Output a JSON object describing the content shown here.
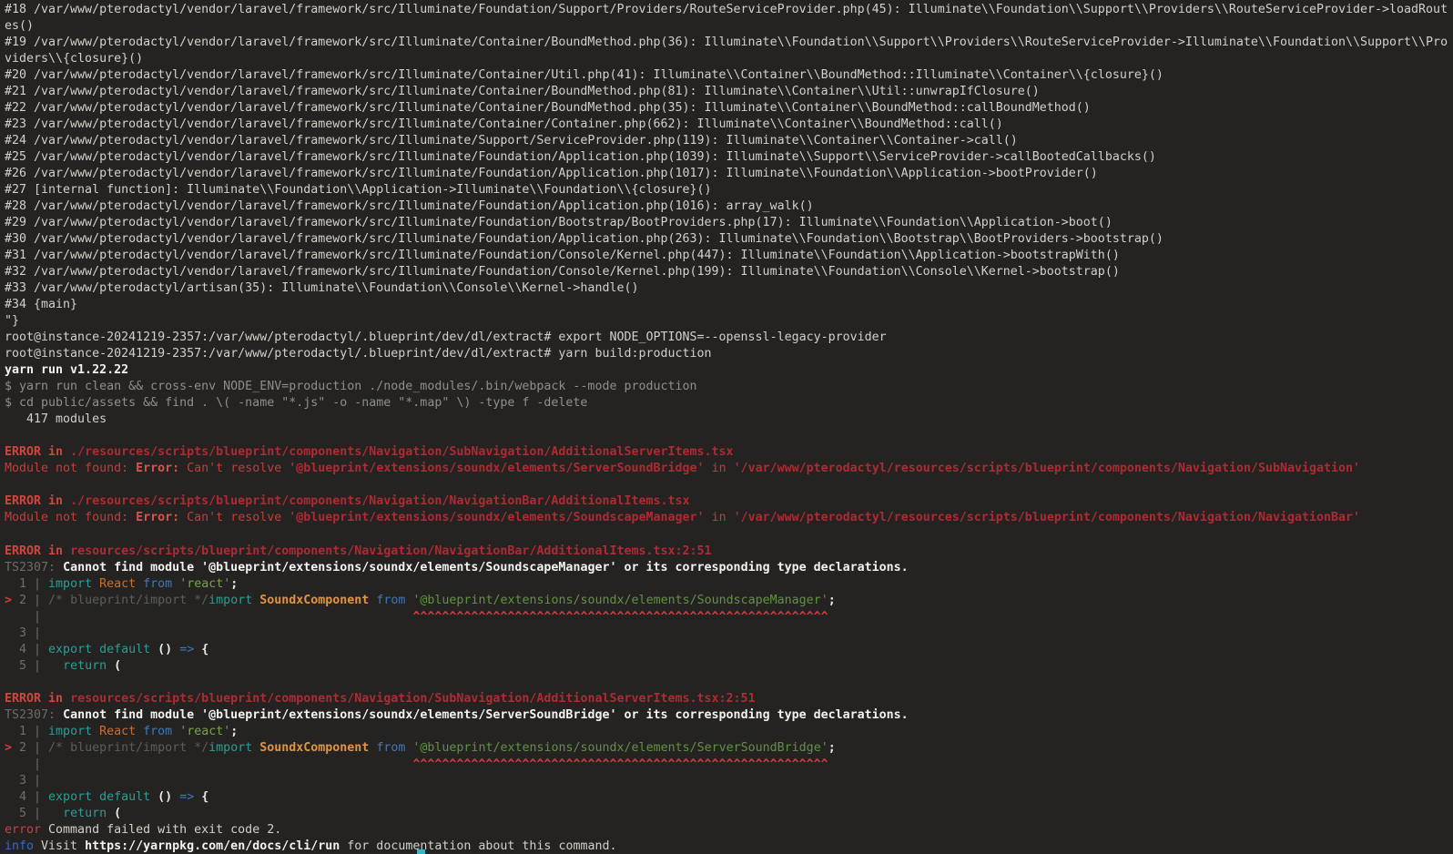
{
  "terminal": {
    "palette": {
      "background": "#242321",
      "foreground": "#d3d0c8",
      "bold_white": "#f4f2ec",
      "dim_gray": "#8f8f8a",
      "error_red": "#c33d3a",
      "error_path_red": "#af2a32",
      "caret_red": "#d33f3f",
      "keyword_teal": "#2b9e95",
      "operator_blue": "#3e78bd",
      "identifier_orange": "#c96f31",
      "string_green": "#7aa24d",
      "comment_gray": "#5d5d58",
      "info_blue": "#2d6cd0",
      "cursor": "#35b5c1"
    },
    "cursor": {
      "visible": true
    },
    "rows": [
      {
        "s": [
          {
            "t": "#18 /var/www/pterodactyl/vendor/laravel/framework/src/Illuminate/Foundation/Support/Providers/RouteServiceProvider.php(45): Illuminate\\\\Foundation\\\\Support\\\\Providers\\\\RouteServiceProvider->loadRout",
            "c": "fg"
          }
        ]
      },
      {
        "s": [
          {
            "t": "es()",
            "c": "fg"
          }
        ]
      },
      {
        "s": [
          {
            "t": "#19 /var/www/pterodactyl/vendor/laravel/framework/src/Illuminate/Container/BoundMethod.php(36): Illuminate\\\\Foundation\\\\Support\\\\Providers\\\\RouteServiceProvider->Illuminate\\\\Foundation\\\\Support\\\\Pro",
            "c": "fg"
          }
        ]
      },
      {
        "s": [
          {
            "t": "viders\\\\{closure}()",
            "c": "fg"
          }
        ]
      },
      {
        "s": [
          {
            "t": "#20 /var/www/pterodactyl/vendor/laravel/framework/src/Illuminate/Container/Util.php(41): Illuminate\\\\Container\\\\BoundMethod::Illuminate\\\\Container\\\\{closure}()",
            "c": "fg"
          }
        ]
      },
      {
        "s": [
          {
            "t": "#21 /var/www/pterodactyl/vendor/laravel/framework/src/Illuminate/Container/BoundMethod.php(81): Illuminate\\\\Container\\\\Util::unwrapIfClosure()",
            "c": "fg"
          }
        ]
      },
      {
        "s": [
          {
            "t": "#22 /var/www/pterodactyl/vendor/laravel/framework/src/Illuminate/Container/BoundMethod.php(35): Illuminate\\\\Container\\\\BoundMethod::callBoundMethod()",
            "c": "fg"
          }
        ]
      },
      {
        "s": [
          {
            "t": "#23 /var/www/pterodactyl/vendor/laravel/framework/src/Illuminate/Container/Container.php(662): Illuminate\\\\Container\\\\BoundMethod::call()",
            "c": "fg"
          }
        ]
      },
      {
        "s": [
          {
            "t": "#24 /var/www/pterodactyl/vendor/laravel/framework/src/Illuminate/Support/ServiceProvider.php(119): Illuminate\\\\Container\\\\Container->call()",
            "c": "fg"
          }
        ]
      },
      {
        "s": [
          {
            "t": "#25 /var/www/pterodactyl/vendor/laravel/framework/src/Illuminate/Foundation/Application.php(1039): Illuminate\\\\Support\\\\ServiceProvider->callBootedCallbacks()",
            "c": "fg"
          }
        ]
      },
      {
        "s": [
          {
            "t": "#26 /var/www/pterodactyl/vendor/laravel/framework/src/Illuminate/Foundation/Application.php(1017): Illuminate\\\\Foundation\\\\Application->bootProvider()",
            "c": "fg"
          }
        ]
      },
      {
        "s": [
          {
            "t": "#27 [internal function]: Illuminate\\\\Foundation\\\\Application->Illuminate\\\\Foundation\\\\{closure}()",
            "c": "fg"
          }
        ]
      },
      {
        "s": [
          {
            "t": "#28 /var/www/pterodactyl/vendor/laravel/framework/src/Illuminate/Foundation/Application.php(1016): array_walk()",
            "c": "fg"
          }
        ]
      },
      {
        "s": [
          {
            "t": "#29 /var/www/pterodactyl/vendor/laravel/framework/src/Illuminate/Foundation/Bootstrap/BootProviders.php(17): Illuminate\\\\Foundation\\\\Application->boot()",
            "c": "fg"
          }
        ]
      },
      {
        "s": [
          {
            "t": "#30 /var/www/pterodactyl/vendor/laravel/framework/src/Illuminate/Foundation/Application.php(263): Illuminate\\\\Foundation\\\\Bootstrap\\\\BootProviders->bootstrap()",
            "c": "fg"
          }
        ]
      },
      {
        "s": [
          {
            "t": "#31 /var/www/pterodactyl/vendor/laravel/framework/src/Illuminate/Foundation/Console/Kernel.php(447): Illuminate\\\\Foundation\\\\Application->bootstrapWith()",
            "c": "fg"
          }
        ]
      },
      {
        "s": [
          {
            "t": "#32 /var/www/pterodactyl/vendor/laravel/framework/src/Illuminate/Foundation/Console/Kernel.php(199): Illuminate\\\\Foundation\\\\Console\\\\Kernel->bootstrap()",
            "c": "fg"
          }
        ]
      },
      {
        "s": [
          {
            "t": "#33 /var/www/pterodactyl/artisan(35): Illuminate\\\\Foundation\\\\Console\\\\Kernel->handle()",
            "c": "fg"
          }
        ]
      },
      {
        "s": [
          {
            "t": "#34 {main}",
            "c": "fg"
          }
        ]
      },
      {
        "s": [
          {
            "t": "\"}",
            "c": "fg"
          }
        ]
      },
      {
        "s": [
          {
            "t": "root@instance-20241219-2357:/var/www/pterodactyl/.blueprint/dev/dl/extract# export NODE_OPTIONS=--openssl-legacy-provider",
            "c": "fg"
          }
        ]
      },
      {
        "s": [
          {
            "t": "root@instance-20241219-2357:/var/www/pterodactyl/.blueprint/dev/dl/extract# yarn build:production",
            "c": "fg"
          }
        ]
      },
      {
        "s": [
          {
            "t": "yarn run v1.22.22",
            "c": "white"
          }
        ]
      },
      {
        "s": [
          {
            "t": "$ yarn run clean && cross-env NODE_ENV=production ./node_modules/.bin/webpack --mode production",
            "c": "dim"
          }
        ]
      },
      {
        "s": [
          {
            "t": "$ cd public/assets && find . \\( -name \"*.js\" -o -name \"*.map\" \\) -type f -delete",
            "c": "dim"
          }
        ]
      },
      {
        "s": [
          {
            "t": "   417 modules",
            "c": "fg"
          }
        ]
      },
      {
        "s": []
      },
      {
        "s": [
          {
            "t": "ERROR in ",
            "c": "err-head"
          },
          {
            "t": "./resources/scripts/blueprint/components/Navigation/SubNavigation/AdditionalServerItems.tsx",
            "c": "err-path"
          }
        ]
      },
      {
        "s": [
          {
            "t": "Module not found: ",
            "c": "err-text"
          },
          {
            "t": "Error:",
            "c": "err-label"
          },
          {
            "t": " Can't resolve ",
            "c": "err-text"
          },
          {
            "t": "'@blueprint/extensions/soundx/elements/ServerSoundBridge'",
            "c": "err-path"
          },
          {
            "t": " in ",
            "c": "err-text"
          },
          {
            "t": "'/var/www/pterodactyl/resources/scripts/blueprint/components/Navigation/SubNavigation'",
            "c": "err-path"
          }
        ]
      },
      {
        "s": []
      },
      {
        "s": [
          {
            "t": "ERROR in ",
            "c": "err-head"
          },
          {
            "t": "./resources/scripts/blueprint/components/Navigation/NavigationBar/AdditionalItems.tsx",
            "c": "err-path"
          }
        ]
      },
      {
        "s": [
          {
            "t": "Module not found: ",
            "c": "err-text"
          },
          {
            "t": "Error:",
            "c": "err-label"
          },
          {
            "t": " Can't resolve ",
            "c": "err-text"
          },
          {
            "t": "'@blueprint/extensions/soundx/elements/SoundscapeManager'",
            "c": "err-path"
          },
          {
            "t": " in ",
            "c": "err-text"
          },
          {
            "t": "'/var/www/pterodactyl/resources/scripts/blueprint/components/Navigation/NavigationBar'",
            "c": "err-path"
          }
        ]
      },
      {
        "s": []
      },
      {
        "s": [
          {
            "t": "ERROR in ",
            "c": "err-head"
          },
          {
            "t": "resources/scripts/blueprint/components/Navigation/NavigationBar/AdditionalItems.tsx:2:51",
            "c": "err-path"
          }
        ]
      },
      {
        "s": [
          {
            "t": "TS2307:",
            "c": "ts"
          },
          {
            "t": " ",
            "c": "fg"
          },
          {
            "t": "Cannot find module '@blueprint/extensions/soundx/elements/SoundscapeManager' or its corresponding type declarations.",
            "c": "white"
          }
        ]
      },
      {
        "s": [
          {
            "t": "  1 | ",
            "c": "gutter"
          },
          {
            "t": "import",
            "c": "kw"
          },
          {
            "t": " ",
            "c": "fg"
          },
          {
            "t": "React",
            "c": "cap"
          },
          {
            "t": " ",
            "c": "fg"
          },
          {
            "t": "from",
            "c": "op"
          },
          {
            "t": " ",
            "c": "fg"
          },
          {
            "t": "'react'",
            "c": "str"
          },
          {
            "t": ";",
            "c": "punct"
          }
        ]
      },
      {
        "s": [
          {
            "t": ">",
            "c": "mark"
          },
          {
            "t": " 2 | ",
            "c": "gutter"
          },
          {
            "t": "/* blueprint/import */",
            "c": "cmt"
          },
          {
            "t": "import",
            "c": "kw"
          },
          {
            "t": " ",
            "c": "fg"
          },
          {
            "t": "SoundxComponent",
            "c": "cap-b"
          },
          {
            "t": " ",
            "c": "fg"
          },
          {
            "t": "from",
            "c": "op"
          },
          {
            "t": " ",
            "c": "fg"
          },
          {
            "t": "'@blueprint/extensions/soundx/elements/SoundscapeManager'",
            "c": "str-d"
          },
          {
            "t": ";",
            "c": "punct"
          }
        ]
      },
      {
        "s": [
          {
            "t": "    | ",
            "c": "gutter"
          },
          {
            "t": "                                                  ",
            "c": "fg"
          },
          {
            "t": "^^^^^^^^^^^^^^^^^^^^^^^^^^^^^^^^^^^^^^^^^^^^^^^^^^^^^^^^^",
            "c": "mark"
          }
        ]
      },
      {
        "s": [
          {
            "t": "  3 |",
            "c": "gutter"
          }
        ]
      },
      {
        "s": [
          {
            "t": "  4 | ",
            "c": "gutter"
          },
          {
            "t": "export",
            "c": "kw"
          },
          {
            "t": " ",
            "c": "fg"
          },
          {
            "t": "default",
            "c": "kw"
          },
          {
            "t": " ",
            "c": "fg"
          },
          {
            "t": "()",
            "c": "punct"
          },
          {
            "t": " ",
            "c": "fg"
          },
          {
            "t": "=>",
            "c": "op"
          },
          {
            "t": " ",
            "c": "fg"
          },
          {
            "t": "{",
            "c": "punct"
          }
        ]
      },
      {
        "s": [
          {
            "t": "  5 | ",
            "c": "gutter"
          },
          {
            "t": "  ",
            "c": "fg"
          },
          {
            "t": "return",
            "c": "kw"
          },
          {
            "t": " ",
            "c": "fg"
          },
          {
            "t": "(",
            "c": "punct"
          }
        ]
      },
      {
        "s": []
      },
      {
        "s": [
          {
            "t": "ERROR in ",
            "c": "err-head"
          },
          {
            "t": "resources/scripts/blueprint/components/Navigation/SubNavigation/AdditionalServerItems.tsx:2:51",
            "c": "err-path"
          }
        ]
      },
      {
        "s": [
          {
            "t": "TS2307:",
            "c": "ts"
          },
          {
            "t": " ",
            "c": "fg"
          },
          {
            "t": "Cannot find module '@blueprint/extensions/soundx/elements/ServerSoundBridge' or its corresponding type declarations.",
            "c": "white"
          }
        ]
      },
      {
        "s": [
          {
            "t": "  1 | ",
            "c": "gutter"
          },
          {
            "t": "import",
            "c": "kw"
          },
          {
            "t": " ",
            "c": "fg"
          },
          {
            "t": "React",
            "c": "cap"
          },
          {
            "t": " ",
            "c": "fg"
          },
          {
            "t": "from",
            "c": "op"
          },
          {
            "t": " ",
            "c": "fg"
          },
          {
            "t": "'react'",
            "c": "str"
          },
          {
            "t": ";",
            "c": "punct"
          }
        ]
      },
      {
        "s": [
          {
            "t": ">",
            "c": "mark"
          },
          {
            "t": " 2 | ",
            "c": "gutter"
          },
          {
            "t": "/* blueprint/import */",
            "c": "cmt"
          },
          {
            "t": "import",
            "c": "kw"
          },
          {
            "t": " ",
            "c": "fg"
          },
          {
            "t": "SoundxComponent",
            "c": "cap-b"
          },
          {
            "t": " ",
            "c": "fg"
          },
          {
            "t": "from",
            "c": "op"
          },
          {
            "t": " ",
            "c": "fg"
          },
          {
            "t": "'@blueprint/extensions/soundx/elements/ServerSoundBridge'",
            "c": "str-d"
          },
          {
            "t": ";",
            "c": "punct"
          }
        ]
      },
      {
        "s": [
          {
            "t": "    | ",
            "c": "gutter"
          },
          {
            "t": "                                                  ",
            "c": "fg"
          },
          {
            "t": "^^^^^^^^^^^^^^^^^^^^^^^^^^^^^^^^^^^^^^^^^^^^^^^^^^^^^^^^^",
            "c": "mark"
          }
        ]
      },
      {
        "s": [
          {
            "t": "  3 |",
            "c": "gutter"
          }
        ]
      },
      {
        "s": [
          {
            "t": "  4 | ",
            "c": "gutter"
          },
          {
            "t": "export",
            "c": "kw"
          },
          {
            "t": " ",
            "c": "fg"
          },
          {
            "t": "default",
            "c": "kw"
          },
          {
            "t": " ",
            "c": "fg"
          },
          {
            "t": "()",
            "c": "punct"
          },
          {
            "t": " ",
            "c": "fg"
          },
          {
            "t": "=>",
            "c": "op"
          },
          {
            "t": " ",
            "c": "fg"
          },
          {
            "t": "{",
            "c": "punct"
          }
        ]
      },
      {
        "s": [
          {
            "t": "  5 | ",
            "c": "gutter"
          },
          {
            "t": "  ",
            "c": "fg"
          },
          {
            "t": "return",
            "c": "kw"
          },
          {
            "t": " ",
            "c": "fg"
          },
          {
            "t": "(",
            "c": "punct"
          }
        ]
      },
      {
        "s": [
          {
            "t": "error",
            "c": "err-word"
          },
          {
            "t": " Command failed with exit code 2.",
            "c": "fg"
          }
        ]
      },
      {
        "s": [
          {
            "t": "info",
            "c": "info-word"
          },
          {
            "t": " Visit ",
            "c": "fg"
          },
          {
            "t": "https://yarnpkg.com/en/docs/cli/run",
            "c": "white"
          },
          {
            "t": " for documentation about this command.",
            "c": "fg"
          }
        ]
      }
    ]
  }
}
